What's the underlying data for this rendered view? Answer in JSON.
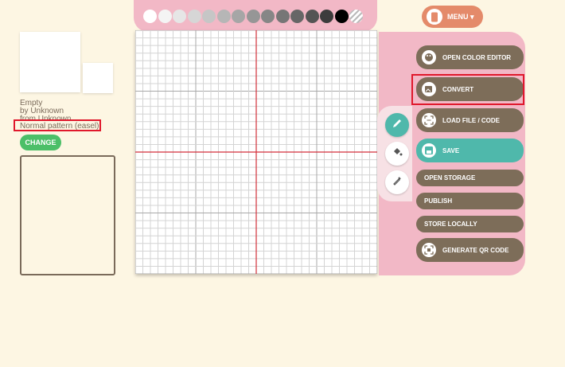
{
  "pattern": {
    "title": "Empty",
    "author": "by Unknown",
    "source": "from Unknown",
    "type": "Normal pattern (easel)",
    "change_label": "CHANGE"
  },
  "palette": {
    "colors": [
      "#ffffff",
      "#f4f4f4",
      "#e6e6e6",
      "#d6d6d6",
      "#c6c6c6",
      "#b6b6b6",
      "#a6a6a6",
      "#969696",
      "#868686",
      "#767676",
      "#666666",
      "#545454",
      "#3c3c3c",
      "#000000"
    ],
    "empty_swatch": "transparent-icon"
  },
  "menu": {
    "label": "MENU ▾"
  },
  "tools": [
    "pencil-icon",
    "fill-bucket-icon",
    "eyedropper-icon"
  ],
  "actions": {
    "open_color_editor": "OPEN COLOR EDITOR",
    "convert": "CONVERT",
    "load_file": "LOAD FILE / CODE",
    "save": "SAVE",
    "open_storage": "OPEN STORAGE",
    "publish": "PUBLISH",
    "store_locally": "STORE LOCALLY",
    "generate_qr": "GENERATE QR CODE"
  },
  "colors": {
    "background": "#fdf6e3",
    "pink": "#f2b8c6",
    "brown_button": "#7d6d59",
    "teal": "#4fb8ab",
    "green": "#4cbf68",
    "highlight": "#e0182c",
    "menu": "#e48a6a"
  }
}
